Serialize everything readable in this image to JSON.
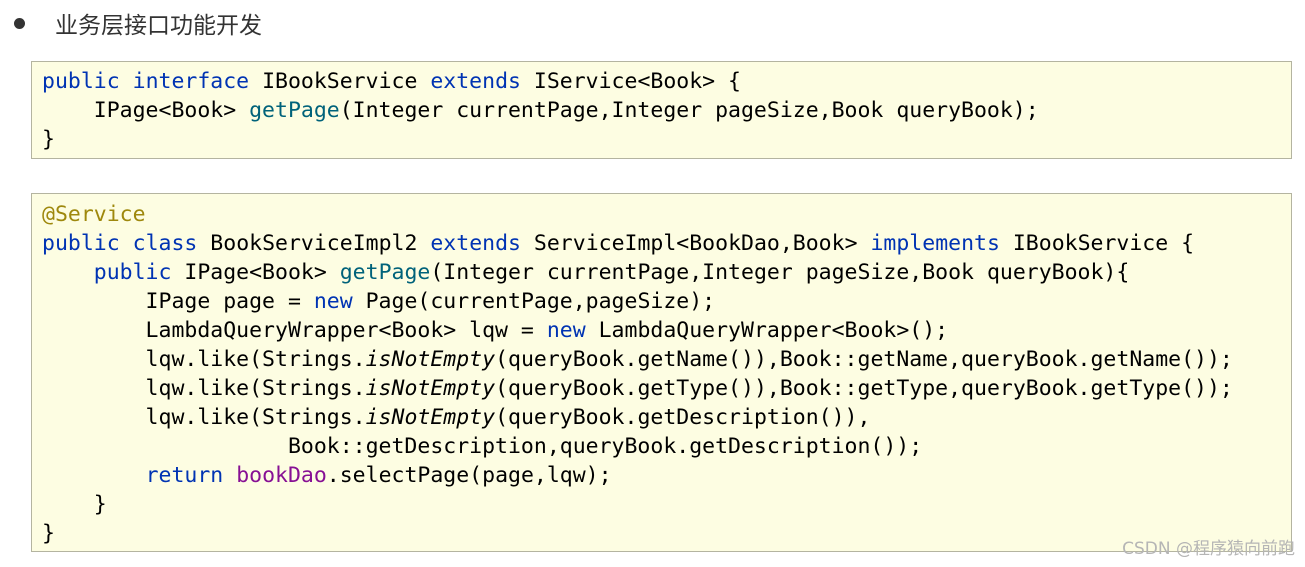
{
  "heading": {
    "text": "业务层接口功能开发"
  },
  "interface_block": {
    "line1": {
      "kw1": "public",
      "sp1": " ",
      "kw2": "interface",
      "t1": " IBookService ",
      "kw3": "extends",
      "t2": " IService<Book> {"
    },
    "line2": {
      "t1": "    IPage<Book> ",
      "fn": "getPage",
      "t2": "(Integer currentPage,Integer pageSize,Book queryBook);"
    },
    "line3": {
      "t1": "}"
    }
  },
  "impl_block": {
    "line1": {
      "ann": "@Service"
    },
    "line2": {
      "kw1": "public",
      "sp1": " ",
      "kw2": "class",
      "t1": " BookServiceImpl2 ",
      "kw3": "extends",
      "t2": " ServiceImpl<BookDao,Book> ",
      "kw4": "implements",
      "t3": " IBookService {"
    },
    "line3": {
      "t0": "    ",
      "kw": "public",
      "t1": " IPage<Book> ",
      "fn": "getPage",
      "t2": "(Integer currentPage,Integer pageSize,Book queryBook){"
    },
    "line4": {
      "t1": "        IPage page = ",
      "kw": "new",
      "t2": " Page(currentPage,pageSize);"
    },
    "line5": {
      "t1": "        LambdaQueryWrapper<Book> lqw = ",
      "kw": "new",
      "t2": " LambdaQueryWrapper<Book>();"
    },
    "line6": {
      "t1": "        lqw.like(Strings.",
      "it": "isNotEmpty",
      "t2": "(queryBook.getName()),Book::getName,queryBook.getName());"
    },
    "line7": {
      "t1": "        lqw.like(Strings.",
      "it": "isNotEmpty",
      "t2": "(queryBook.getType()),Book::getType,queryBook.getType());"
    },
    "line8": {
      "t1": "        lqw.like(Strings.",
      "it": "isNotEmpty",
      "t2": "(queryBook.getDescription()),"
    },
    "line9": {
      "t1": "                   Book::getDescription,queryBook.getDescription());"
    },
    "line10": {
      "t0": "        ",
      "kw": "return",
      "t1": " ",
      "fld": "bookDao",
      "t2": ".selectPage(page,lqw);"
    },
    "line11": {
      "t1": "    }"
    },
    "line12": {
      "t1": "}"
    }
  },
  "watermark": {
    "text": "CSDN @程序猿向前跑"
  },
  "colors": {
    "keyword": "#0033b3",
    "method": "#00627a",
    "annotation": "#9e880d",
    "field": "#871094",
    "code_background": "#fdfde2"
  }
}
